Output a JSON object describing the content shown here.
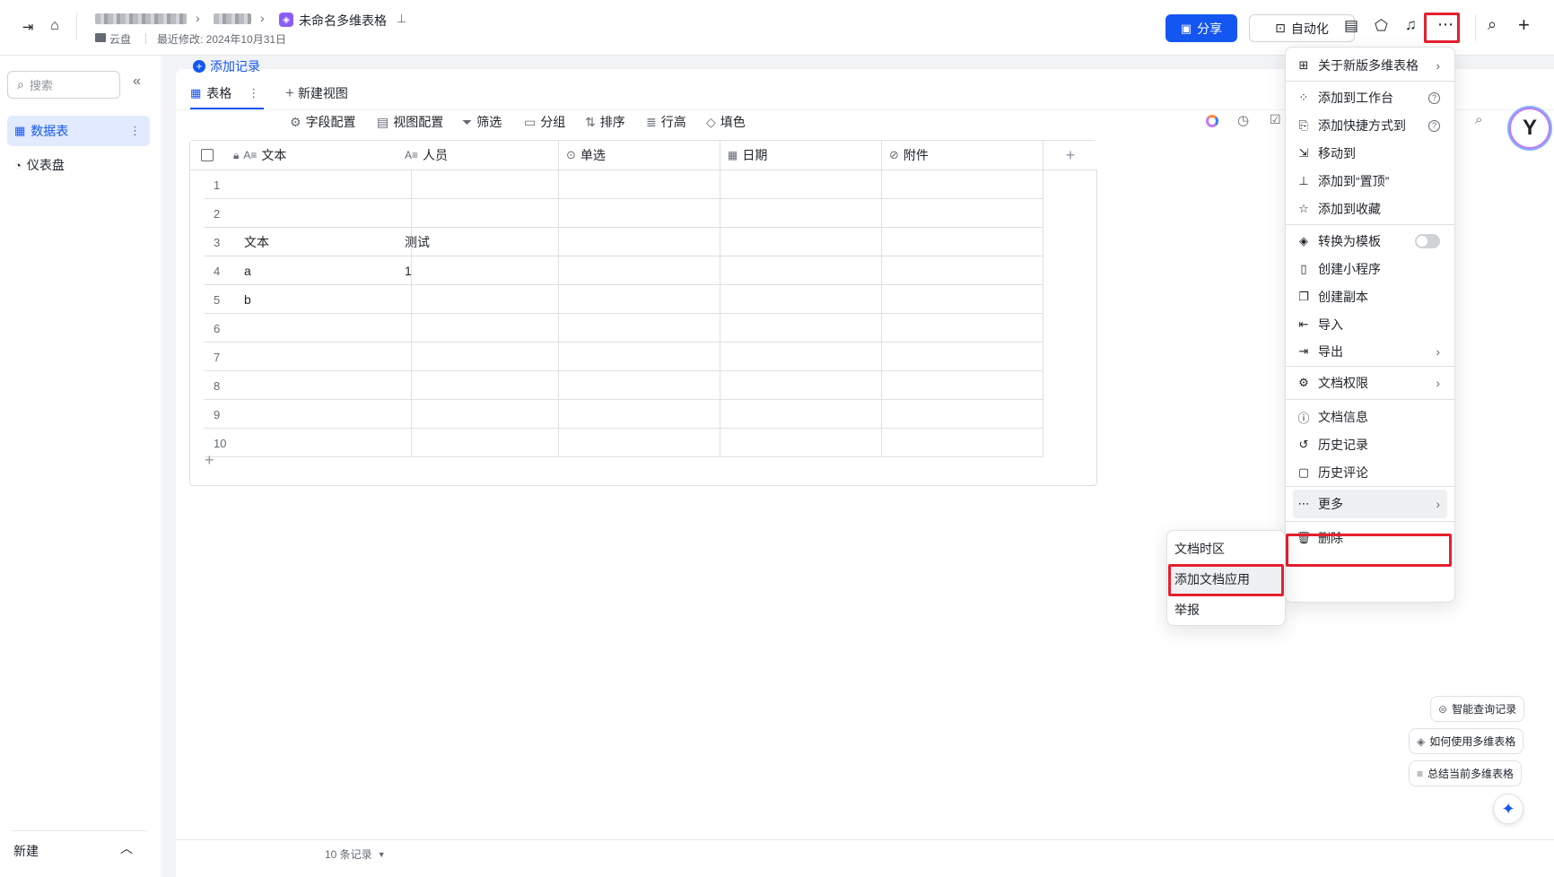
{
  "topbar": {
    "doc_title": "未命名多维表格",
    "location": "云盘",
    "last_modified": "最近修改: 2024年10月31日",
    "share_label": "分享",
    "automation_label": "自动化"
  },
  "sidebar": {
    "search_placeholder": "搜索",
    "items": [
      {
        "label": "数据表",
        "active": true
      },
      {
        "label": "仪表盘",
        "active": false
      }
    ],
    "new_label": "新建"
  },
  "tabs": {
    "table_tab": "表格",
    "new_view": "新建视图"
  },
  "toolbar": {
    "add_record": "添加记录",
    "field_config": "字段配置",
    "view_config": "视图配置",
    "filter": "筛选",
    "group": "分组",
    "sort": "排序",
    "row_height": "行高",
    "fill_color": "填色"
  },
  "table": {
    "columns": [
      "文本",
      "人员",
      "单选",
      "日期",
      "附件"
    ],
    "rows": [
      {
        "num": "1",
        "text": "",
        "person": ""
      },
      {
        "num": "2",
        "text": "",
        "person": ""
      },
      {
        "num": "3",
        "text": "文本",
        "person": "测试"
      },
      {
        "num": "4",
        "text": "a",
        "person": "1"
      },
      {
        "num": "5",
        "text": "b",
        "person": ""
      },
      {
        "num": "6",
        "text": "",
        "person": ""
      },
      {
        "num": "7",
        "text": "",
        "person": ""
      },
      {
        "num": "8",
        "text": "",
        "person": ""
      },
      {
        "num": "9",
        "text": "",
        "person": ""
      },
      {
        "num": "10",
        "text": "",
        "person": ""
      }
    ],
    "record_count": "10 条记录"
  },
  "menu": {
    "items": [
      {
        "label": "关于新版多维表格",
        "icon": "grid-icon",
        "arrow": true
      },
      {
        "label": "添加到工作台",
        "icon": "apps-icon",
        "help": true
      },
      {
        "label": "添加快捷方式到",
        "icon": "shortcut-icon",
        "help": true
      },
      {
        "label": "移动到",
        "icon": "move-icon"
      },
      {
        "label": "添加到“置顶”",
        "icon": "pin-icon"
      },
      {
        "label": "添加到收藏",
        "icon": "star-icon"
      },
      {
        "label": "转换为模板",
        "icon": "template-icon",
        "toggle": true
      },
      {
        "label": "创建小程序",
        "icon": "mini-program-icon"
      },
      {
        "label": "创建副本",
        "icon": "copy-icon"
      },
      {
        "label": "导入",
        "icon": "import-icon"
      },
      {
        "label": "导出",
        "icon": "export-icon",
        "arrow": true
      },
      {
        "label": "文档权限",
        "icon": "settings-icon",
        "arrow": true
      },
      {
        "label": "文档信息",
        "icon": "info-icon"
      },
      {
        "label": "历史记录",
        "icon": "history-icon"
      },
      {
        "label": "历史评论",
        "icon": "comment-history-icon"
      },
      {
        "label": "更多",
        "icon": "more-icon",
        "arrow": true
      },
      {
        "label": "删除",
        "icon": "trash-icon"
      }
    ]
  },
  "submenu": {
    "items": [
      "文档时区",
      "添加文档应用",
      "举报"
    ]
  },
  "ai_chips": {
    "smart_query": "智能查询记录",
    "how_to_use": "如何使用多维表格",
    "summarize": "总结当前多维表格"
  },
  "colors": {
    "primary": "#1456f0",
    "highlight": "#e5202d",
    "doc_icon": "#8b5cf6"
  }
}
